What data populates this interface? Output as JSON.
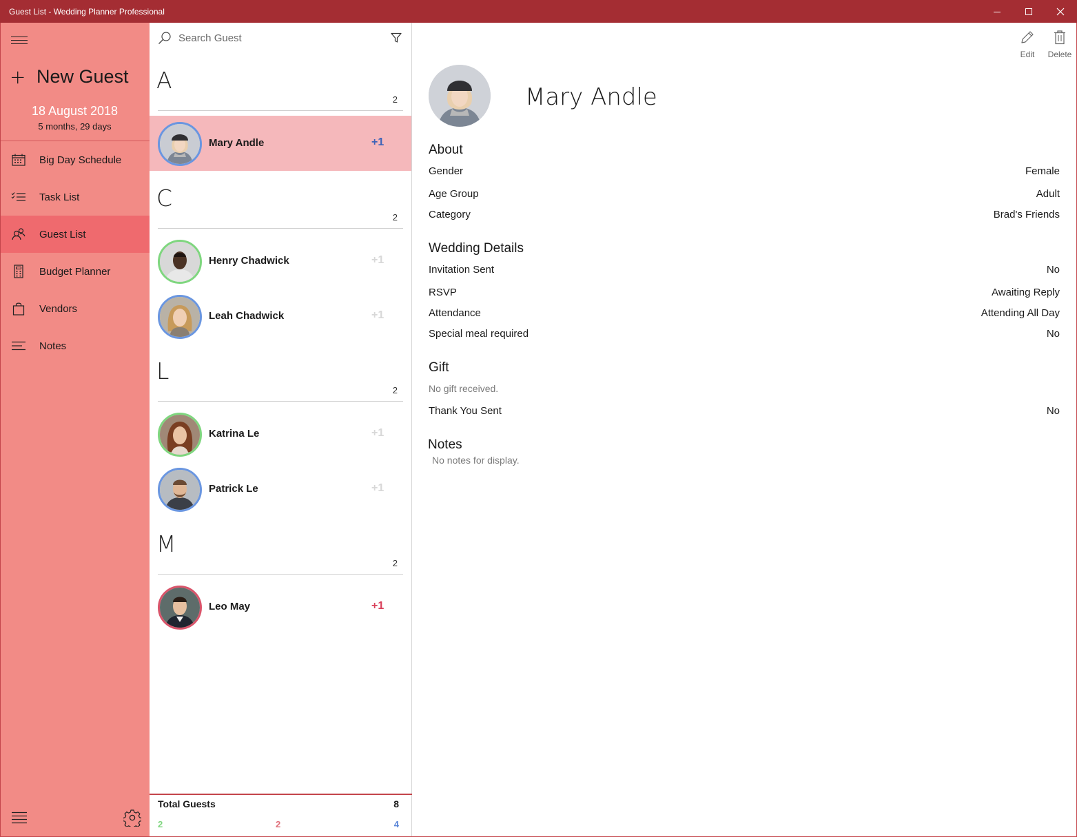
{
  "window": {
    "title": "Guest List - Wedding Planner Professional"
  },
  "sidebar": {
    "new_guest_label": "New Guest",
    "wedding_date": "18 August 2018",
    "countdown": "5 months, 29 days",
    "items": [
      {
        "label": "Big Day Schedule",
        "icon": "calendar-icon"
      },
      {
        "label": "Task List",
        "icon": "checklist-icon"
      },
      {
        "label": "Guest List",
        "icon": "people-icon",
        "active": true
      },
      {
        "label": "Budget Planner",
        "icon": "calculator-icon"
      },
      {
        "label": "Vendors",
        "icon": "shopping-bag-icon"
      },
      {
        "label": "Notes",
        "icon": "notes-icon"
      }
    ]
  },
  "list": {
    "search_placeholder": "Search Guest",
    "groups": [
      {
        "letter": "A",
        "count": "2",
        "guests": [
          {
            "name": "Mary Andle",
            "plus": "+1",
            "ring": "blue",
            "plus_color": "blue",
            "selected": true
          }
        ]
      },
      {
        "letter": "C",
        "count": "2",
        "guests": [
          {
            "name": "Henry Chadwick",
            "plus": "+1",
            "ring": "green",
            "plus_color": "faded"
          },
          {
            "name": "Leah Chadwick",
            "plus": "+1",
            "ring": "blue",
            "plus_color": "faded"
          }
        ]
      },
      {
        "letter": "L",
        "count": "2",
        "guests": [
          {
            "name": "Katrina Le",
            "plus": "+1",
            "ring": "green",
            "plus_color": "faded"
          },
          {
            "name": "Patrick Le",
            "plus": "+1",
            "ring": "blue",
            "plus_color": "faded"
          }
        ]
      },
      {
        "letter": "M",
        "count": "2",
        "guests": [
          {
            "name": "Leo May",
            "plus": "+1",
            "ring": "red",
            "plus_color": "red"
          }
        ]
      }
    ],
    "totals": {
      "label": "Total Guests",
      "value": "8",
      "green_count": "2",
      "red_count": "2",
      "blue_count": "4"
    }
  },
  "detail": {
    "edit_label": "Edit",
    "delete_label": "Delete",
    "name": "Mary Andle",
    "about_heading": "About",
    "about": [
      {
        "label": "Gender",
        "value": "Female"
      },
      {
        "label": "Age Group",
        "value": "Adult"
      },
      {
        "label": "Category",
        "value": "Brad's Friends"
      }
    ],
    "wedding_heading": "Wedding Details",
    "wedding": [
      {
        "label": "Invitation Sent",
        "value": "No"
      },
      {
        "label": "RSVP",
        "value": "Awaiting Reply"
      },
      {
        "label": "Attendance",
        "value": "Attending All Day"
      },
      {
        "label": "Special meal required",
        "value": "No"
      }
    ],
    "gift_heading": "Gift",
    "gift_text": "No gift received.",
    "thank_you": {
      "label": "Thank You Sent",
      "value": "No"
    },
    "notes_heading": "Notes",
    "notes_text": "No notes for display."
  },
  "colors": {
    "titlebar": "#a42d33",
    "sidebar": "#f28b86",
    "sidebar_active": "#ef6a6e",
    "selected_row": "#f5b8bb",
    "ring_blue": "#6a96e0",
    "ring_green": "#7fd67f",
    "ring_red": "#d9546a"
  }
}
